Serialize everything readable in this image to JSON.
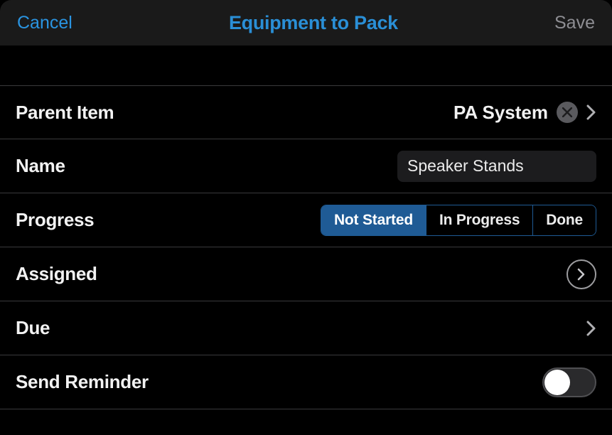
{
  "header": {
    "cancel_label": "Cancel",
    "title": "Equipment to Pack",
    "save_label": "Save"
  },
  "rows": {
    "parent": {
      "label": "Parent Item",
      "value": "PA System"
    },
    "name": {
      "label": "Name",
      "value": "Speaker Stands"
    },
    "progress": {
      "label": "Progress",
      "options": [
        "Not Started",
        "In Progress",
        "Done"
      ],
      "selected_index": 0
    },
    "assigned": {
      "label": "Assigned"
    },
    "due": {
      "label": "Due"
    },
    "reminder": {
      "label": "Send Reminder",
      "value": false
    }
  }
}
